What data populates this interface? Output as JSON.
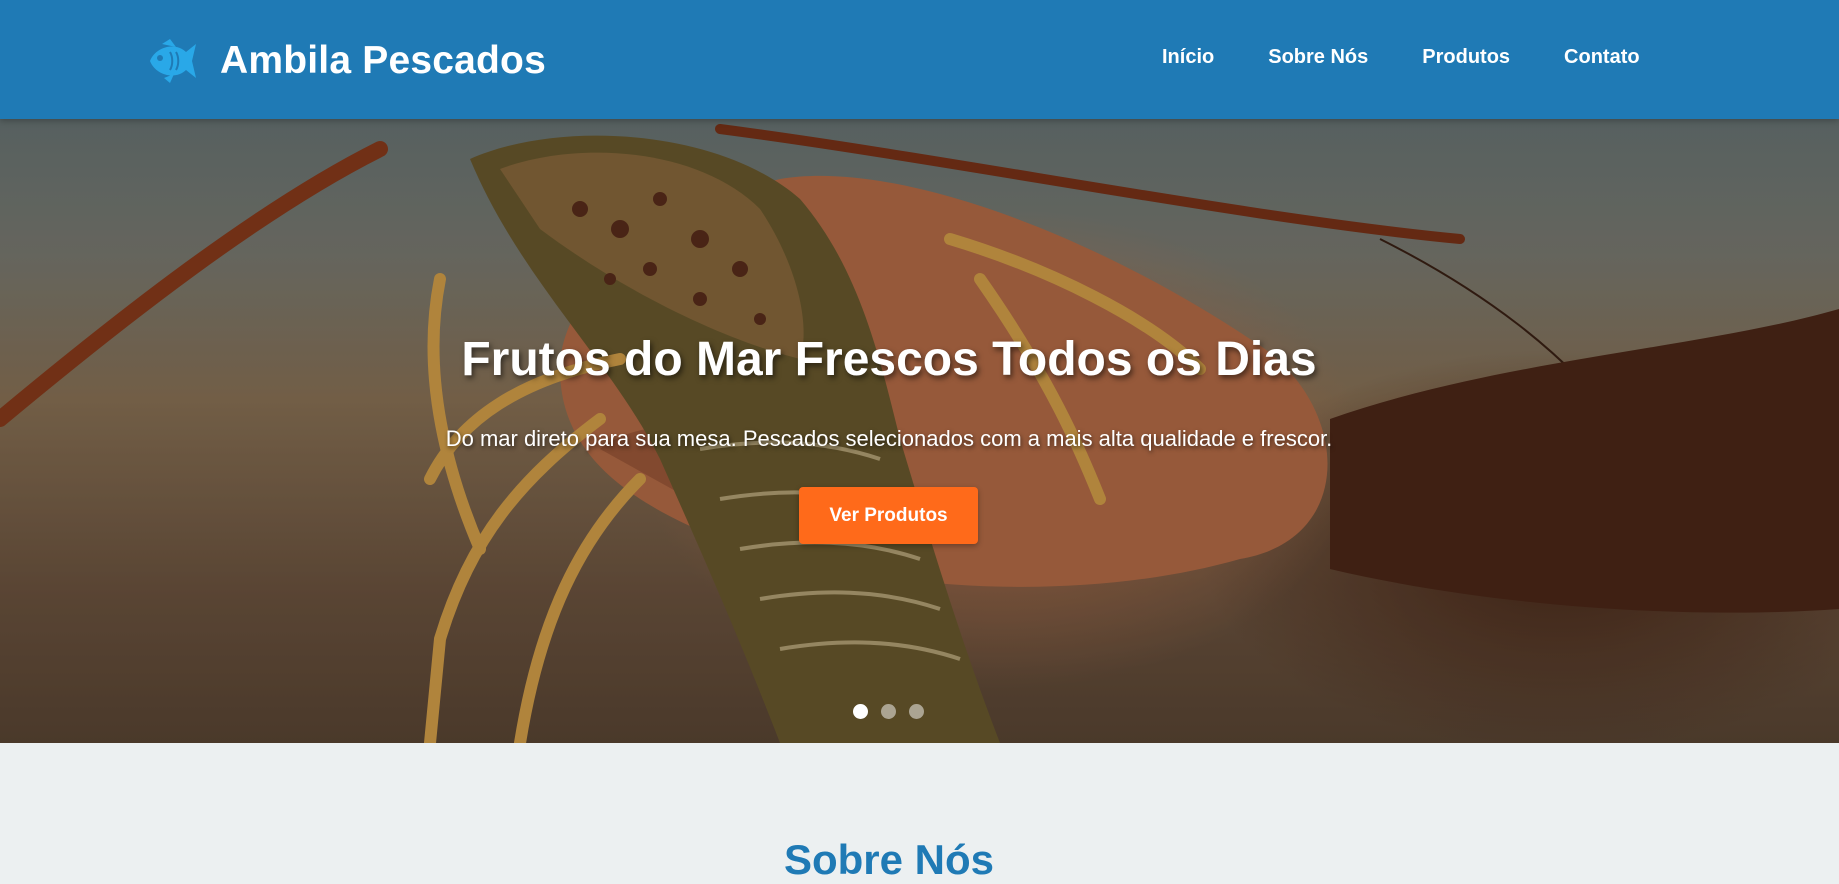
{
  "header": {
    "logo_icon": "fish-icon",
    "brand_name": "Ambila Pescados",
    "nav": [
      {
        "label": "Início"
      },
      {
        "label": "Sobre Nós"
      },
      {
        "label": "Produtos"
      },
      {
        "label": "Contato"
      }
    ]
  },
  "hero": {
    "image_description_icon": "lobster-photo",
    "title": "Frutos do Mar Frescos Todos os Dias",
    "subtitle": "Do mar direto para sua mesa. Pescados selecionados com a mais alta qualidade e frescor.",
    "cta_label": "Ver Produtos",
    "slides_total": 3,
    "active_slide": 1
  },
  "about": {
    "title": "Sobre Nós"
  },
  "colors": {
    "primary": "#1f7ab5",
    "accent": "#ff6a1a",
    "section_bg": "#ecf0f1",
    "logo_icon": "#29a8e8"
  }
}
